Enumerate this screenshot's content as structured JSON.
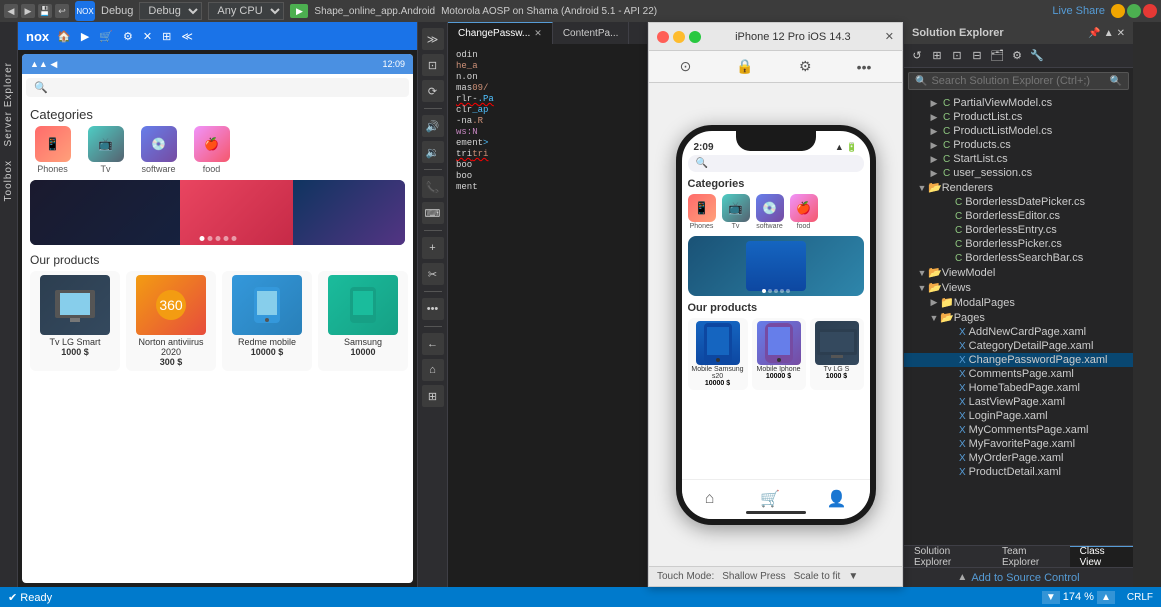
{
  "topbar": {
    "logo": "◀",
    "debug_label": "Debug",
    "any_cpu": "Any CPU",
    "app_title": "Shape_online_app.Android",
    "device": "Motorola AOSP on Shama (Android 5.1 - API 22)",
    "live_share": "Live Share",
    "pin_icon": "📌",
    "settings_icon": "⚙"
  },
  "android_emulator": {
    "title": "Nox",
    "status_time": "12:09",
    "search_placeholder": "🔍",
    "categories_label": "Categories",
    "categories": [
      {
        "name": "Phones",
        "type": "phones"
      },
      {
        "name": "Tv",
        "type": "tv"
      },
      {
        "name": "software",
        "type": "software"
      },
      {
        "name": "food",
        "type": "food"
      }
    ],
    "products_label": "Our products",
    "products": [
      {
        "name": "Tv LG Smart",
        "price": "1000 $",
        "type": "tv"
      },
      {
        "name": "Norton antiviirus 2020",
        "price": "300 $",
        "type": "norton"
      },
      {
        "name": "Redme mobile",
        "price": "10000 $",
        "type": "redme"
      },
      {
        "name": "Samsung",
        "price": "10000",
        "type": "samsung"
      }
    ]
  },
  "ios_simulator": {
    "title": "iPhone 12 Pro iOS 14.3",
    "status_time": "2:09",
    "search_placeholder": "🔍",
    "categories_label": "Categories",
    "categories": [
      {
        "name": "Phones",
        "type": "phones"
      },
      {
        "name": "Tv",
        "type": "tv"
      },
      {
        "name": "software",
        "type": "software"
      },
      {
        "name": "food",
        "type": "food"
      }
    ],
    "products_label": "Our products",
    "products": [
      {
        "name": "Mobile Samsung s20",
        "price": "10000 $",
        "type": "samsung"
      },
      {
        "name": "Mobile Iphone",
        "price": "10000 $",
        "type": "iphone"
      },
      {
        "name": "Tv LG S",
        "price": "1000 $",
        "type": "tv"
      }
    ],
    "touch_mode": "Touch Mode:",
    "shallow_press": "Shallow Press",
    "scale": "Scale to fit"
  },
  "code_editor": {
    "tabs": [
      {
        "label": "ChangePassw...",
        "active": true
      },
      {
        "label": "ContentPa...",
        "active": false
      }
    ],
    "lines": [
      {
        "num": "",
        "code": "odin"
      },
      {
        "num": "",
        "code": "he_a"
      },
      {
        "num": "",
        "code": "n.on"
      },
      {
        "num": "",
        "code": "mas"
      },
      {
        "num": "",
        "code": "rlr-"
      },
      {
        "num": "",
        "code": "clr"
      },
      {
        "num": "",
        "code": "-na"
      },
      {
        "num": "",
        "code": "ws:N"
      },
      {
        "num": "",
        "code": "ement"
      },
      {
        "num": "",
        "code": "tri"
      },
      {
        "num": "",
        "code": "boo"
      },
      {
        "num": "",
        "code": "boo"
      },
      {
        "num": "",
        "code": "ment"
      }
    ]
  },
  "solution_explorer": {
    "title": "Solution Explorer",
    "search_placeholder": "Search Solution Explorer (Ctrl+;)",
    "tree": [
      {
        "indent": 1,
        "type": "cs",
        "name": "PartialViewModel.cs",
        "has_arrow": true
      },
      {
        "indent": 1,
        "type": "cs",
        "name": "ProductList.cs",
        "has_arrow": true
      },
      {
        "indent": 1,
        "type": "cs",
        "name": "ProductListModel.cs",
        "has_arrow": true
      },
      {
        "indent": 1,
        "type": "cs",
        "name": "Products.cs",
        "has_arrow": true
      },
      {
        "indent": 1,
        "type": "cs",
        "name": "StartList.cs",
        "has_arrow": true
      },
      {
        "indent": 1,
        "type": "cs",
        "name": "user_session.cs",
        "has_arrow": true
      },
      {
        "indent": 0,
        "type": "folder",
        "name": "Renderers",
        "has_arrow": true,
        "expanded": true
      },
      {
        "indent": 1,
        "type": "cs",
        "name": "BorderlessDatePicker.cs",
        "has_arrow": false
      },
      {
        "indent": 1,
        "type": "cs",
        "name": "BorderlessEditor.cs",
        "has_arrow": false
      },
      {
        "indent": 1,
        "type": "cs",
        "name": "BorderlessEntry.cs",
        "has_arrow": false
      },
      {
        "indent": 1,
        "type": "cs",
        "name": "BorderlessPicker.cs",
        "has_arrow": false
      },
      {
        "indent": 1,
        "type": "cs",
        "name": "BorderlessSearchBar.cs",
        "has_arrow": false
      },
      {
        "indent": 0,
        "type": "folder",
        "name": "ViewModel",
        "has_arrow": true,
        "expanded": true
      },
      {
        "indent": 0,
        "type": "folder",
        "name": "Views",
        "has_arrow": true,
        "expanded": true
      },
      {
        "indent": 1,
        "type": "folder",
        "name": "ModalPages",
        "has_arrow": true
      },
      {
        "indent": 1,
        "type": "folder",
        "name": "Pages",
        "has_arrow": true,
        "expanded": true
      },
      {
        "indent": 2,
        "type": "xaml",
        "name": "AddNewCardPage.xaml",
        "has_arrow": false
      },
      {
        "indent": 2,
        "type": "xaml",
        "name": "CategoryDetailPage.xaml",
        "has_arrow": false
      },
      {
        "indent": 2,
        "type": "xaml",
        "name": "ChangePasswordPage.xaml",
        "has_arrow": false,
        "selected": true
      },
      {
        "indent": 2,
        "type": "xaml",
        "name": "CommentsPage.xaml",
        "has_arrow": false
      },
      {
        "indent": 2,
        "type": "xaml",
        "name": "HomeTabedPage.xaml",
        "has_arrow": false
      },
      {
        "indent": 2,
        "type": "xaml",
        "name": "LastViewPage.xaml",
        "has_arrow": false
      },
      {
        "indent": 2,
        "type": "xaml",
        "name": "LoginPage.xaml",
        "has_arrow": false
      },
      {
        "indent": 2,
        "type": "xaml",
        "name": "MyCommentsPage.xaml",
        "has_arrow": false
      },
      {
        "indent": 2,
        "type": "xaml",
        "name": "MyFavoritePage.xaml",
        "has_arrow": false
      },
      {
        "indent": 2,
        "type": "xaml",
        "name": "MyOrderPage.xaml",
        "has_arrow": false
      },
      {
        "indent": 2,
        "type": "xaml",
        "name": "ProductDetail.xaml",
        "has_arrow": false
      }
    ],
    "footer_tabs": [
      {
        "label": "Solution Explorer",
        "active": false
      },
      {
        "label": "Team Explorer",
        "active": false
      },
      {
        "label": "Class View",
        "active": true
      }
    ],
    "add_source_control": "Add to Source Control"
  },
  "status_bar": {
    "ready": "✔ Ready",
    "zoom": "174 %",
    "crlf": "CRLF"
  }
}
